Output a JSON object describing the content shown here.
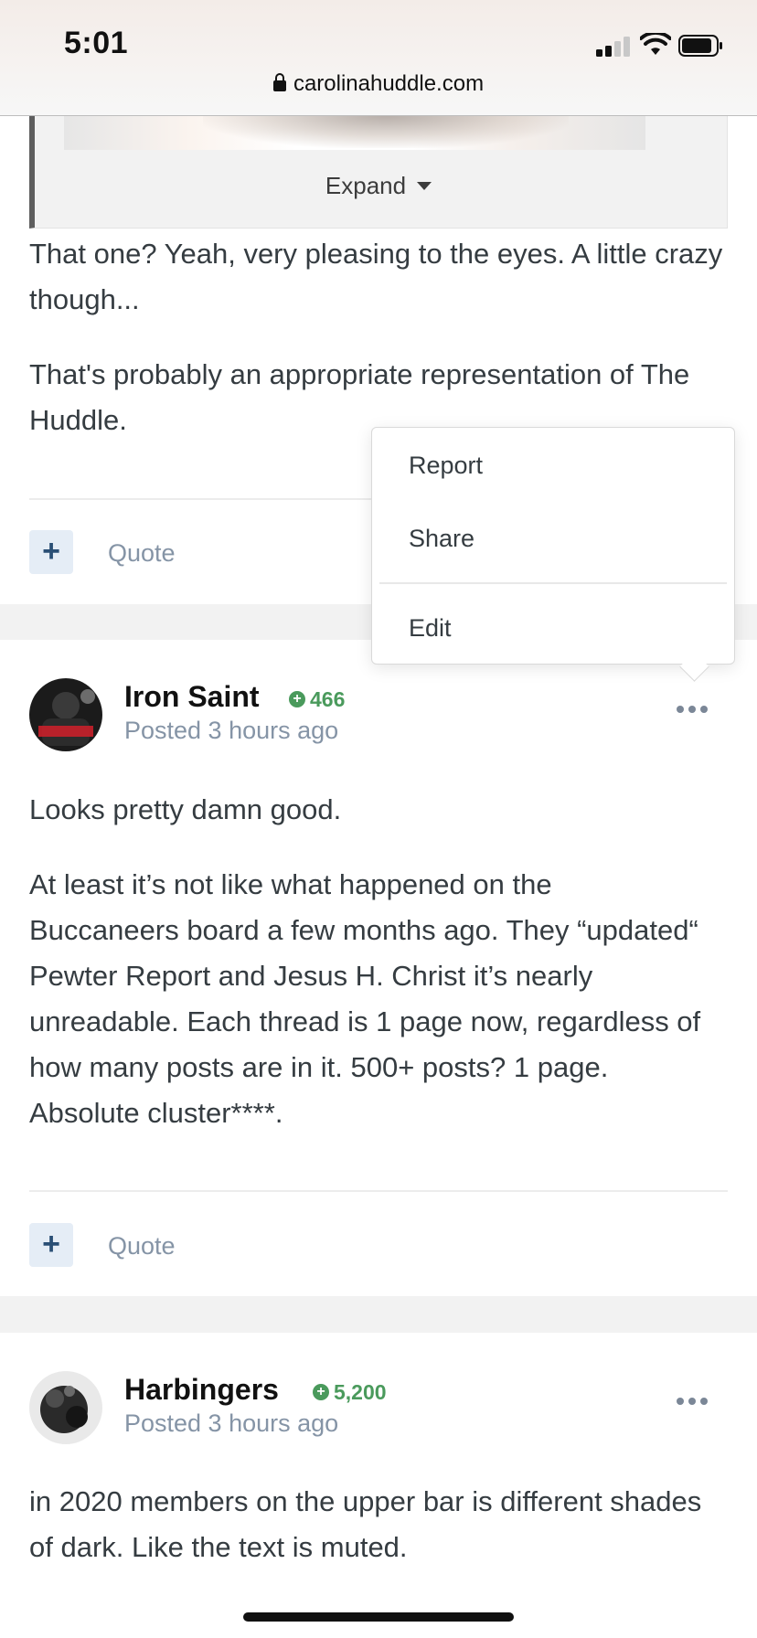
{
  "status_bar": {
    "time": "5:01"
  },
  "browser": {
    "url": "carolinahuddle.com"
  },
  "post1": {
    "expand_label": "Expand",
    "paragraphs": [
      "That one? Yeah, very pleasing to the eyes. A little crazy though...",
      "That's probably an appropriate representation of The Huddle."
    ],
    "add_label": "+",
    "quote_label": "Quote"
  },
  "menu": {
    "items": [
      "Report",
      "Share",
      "Edit"
    ]
  },
  "post2": {
    "author": "Iron Saint",
    "reputation": "466",
    "posted": "Posted 3 hours ago",
    "paragraphs": [
      "Looks pretty damn good.",
      "At least it’s not like what happened on the Buccaneers board a few months ago. They “updated“ Pewter Report and Jesus H. Christ it’s nearly unreadable. Each thread is 1 page now, regardless of how many posts are in it. 500+ posts? 1 page. Absolute cluster****."
    ],
    "add_label": "+",
    "quote_label": "Quote"
  },
  "post3": {
    "author": "Harbingers",
    "reputation": "5,200",
    "posted": "Posted 3 hours ago",
    "paragraphs": [
      "in 2020 members on the upper bar is different shades of dark. Like the text is muted."
    ]
  },
  "icons": {
    "reputation": "plus-circle-icon",
    "more": "ellipsis-icon",
    "lock": "lock-icon"
  },
  "colors": {
    "reputation_green": "#4a9a5c",
    "link_gray": "#8594a6",
    "plus_button_bg": "#e5edf6"
  }
}
